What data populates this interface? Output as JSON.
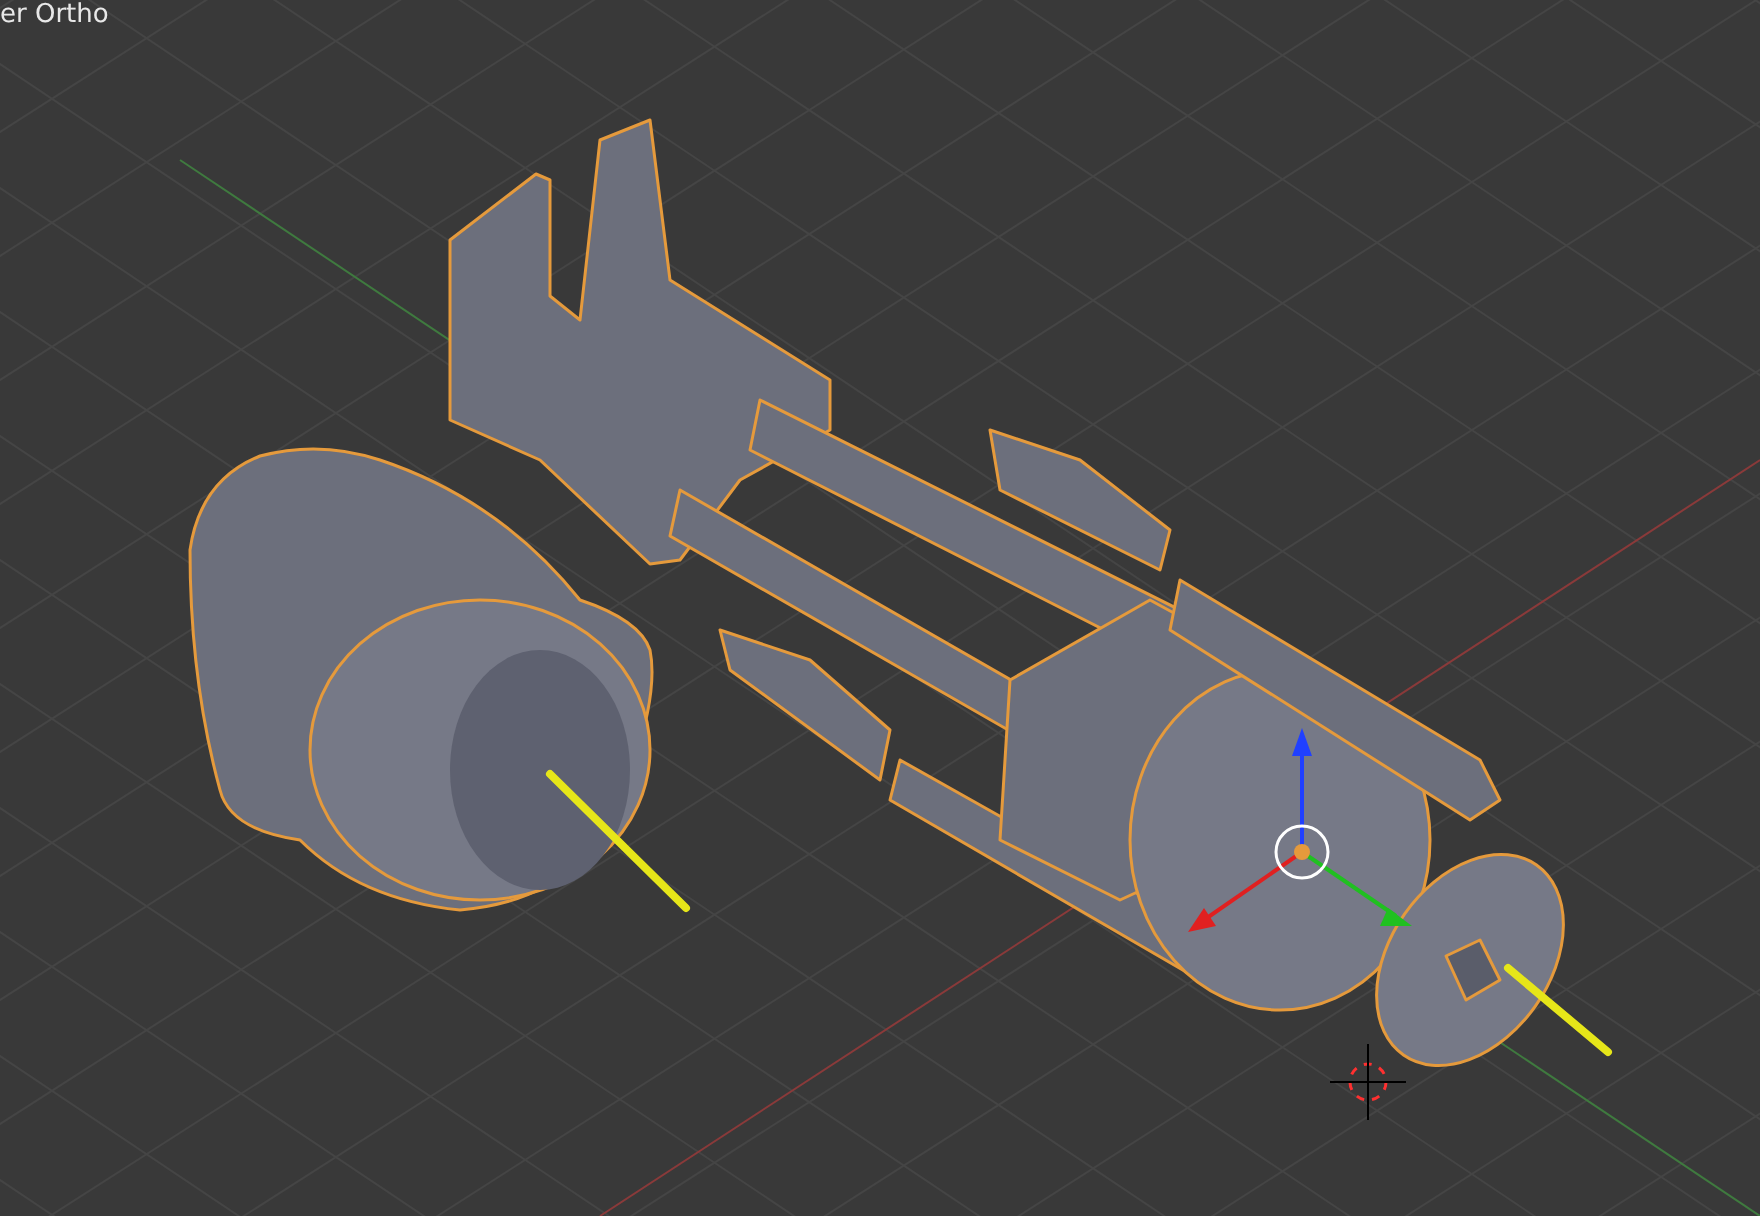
{
  "viewport": {
    "view_label": "er Ortho"
  }
}
